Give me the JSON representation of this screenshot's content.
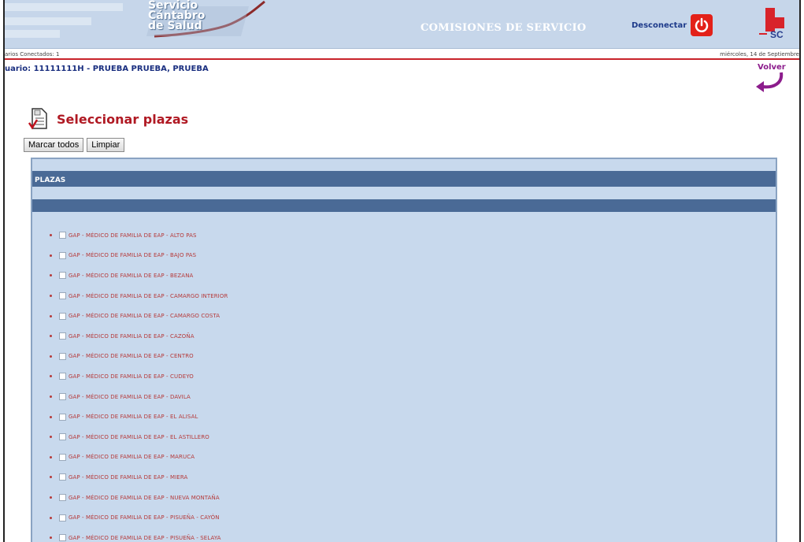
{
  "header": {
    "logo_line1": "Servicio",
    "logo_line2": "Cántabro",
    "logo_line3": "de Salud",
    "app_title": "COMISIONES DE SERVICIO",
    "logout_label": "Desconectar",
    "brand_logo_text": "SC",
    "colors": {
      "banner": "#c6d6ea",
      "accent_red": "#e32119",
      "title_red": "#b01923",
      "panel": "#c8d9ed",
      "bar": "#4a6a96"
    }
  },
  "infobar": {
    "users_connected": "arios Conectados: 1",
    "date": "miércoles, 14 de Septiembre"
  },
  "user": {
    "line": "uario: 11111111H - PRUEBA PRUEBA, PRUEBA"
  },
  "nav": {
    "back_label": "Volver"
  },
  "section": {
    "title": "Seleccionar plazas",
    "mark_all": "Marcar todos",
    "clear": "Limpiar"
  },
  "panel": {
    "header": "PLAZAS",
    "items": [
      "GAP - MÉDICO DE FAMILIA DE EAP - ALTO PAS",
      "GAP - MÉDICO DE FAMILIA DE EAP - BAJO PAS",
      "GAP - MÉDICO DE FAMILIA DE EAP - BEZANA",
      "GAP - MÉDICO DE FAMILIA DE EAP - CAMARGO INTERIOR",
      "GAP - MÉDICO DE FAMILIA DE EAP - CAMARGO COSTA",
      "GAP - MÉDICO DE FAMILIA DE EAP - CAZOÑA",
      "GAP - MÉDICO DE FAMILIA DE EAP - CENTRO",
      "GAP - MÉDICO DE FAMILIA DE EAP - CUDEYO",
      "GAP - MÉDICO DE FAMILIA DE EAP - DAVILA",
      "GAP - MÉDICO DE FAMILIA DE EAP - EL ALISAL",
      "GAP - MÉDICO DE FAMILIA DE EAP - EL ASTILLERO",
      "GAP - MÉDICO DE FAMILIA DE EAP - MARUCA",
      "GAP - MÉDICO DE FAMILIA DE EAP - MIERA",
      "GAP - MÉDICO DE FAMILIA DE EAP - NUEVA MONTAÑA",
      "GAP - MÉDICO DE FAMILIA DE EAP - PISUEÑA - CAYÓN",
      "GAP - MÉDICO DE FAMILIA DE EAP - PISUEÑA - SELAYA"
    ]
  }
}
